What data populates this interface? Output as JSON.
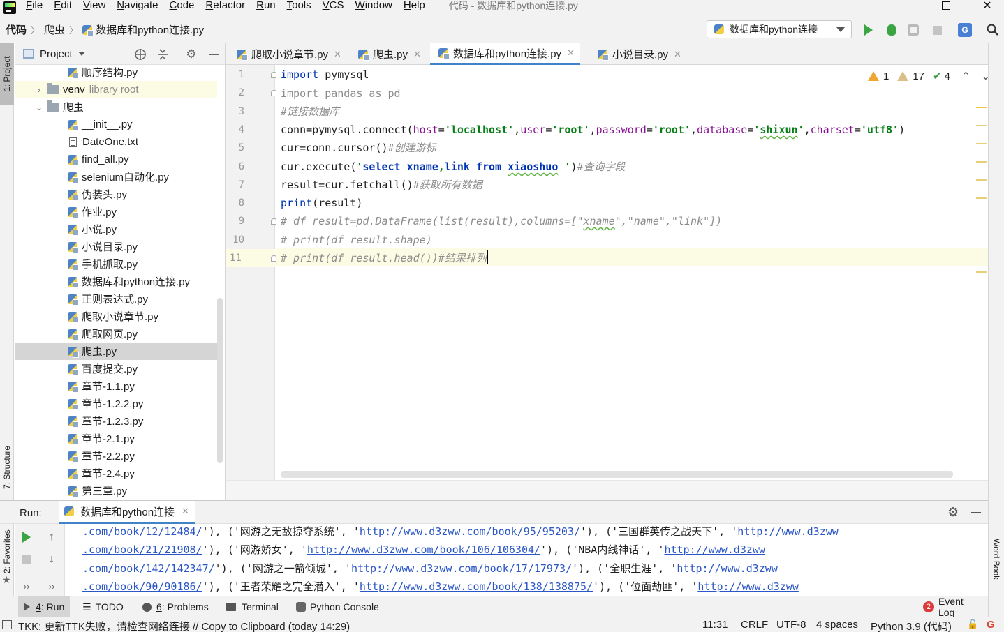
{
  "menubar": {
    "items": [
      {
        "label": "File",
        "u": "F",
        "rest": "ile"
      },
      {
        "label": "Edit",
        "u": "E",
        "rest": "dit"
      },
      {
        "label": "View",
        "u": "V",
        "rest": "iew"
      },
      {
        "label": "Navigate",
        "u": "N",
        "rest": "avigate"
      },
      {
        "label": "Code",
        "u": "C",
        "rest": "ode"
      },
      {
        "label": "Refactor",
        "u": "R",
        "rest": "efactor"
      },
      {
        "label": "Run",
        "u": "R",
        "rest": "un"
      },
      {
        "label": "Tools",
        "u": "T",
        "rest": "ools"
      },
      {
        "label": "VCS",
        "u": "V",
        "rest": "CS"
      },
      {
        "label": "Window",
        "u": "W",
        "rest": "indow"
      },
      {
        "label": "Help",
        "u": "H",
        "rest": "elp"
      }
    ],
    "window_title": "代码 - 数据库和python连接.py"
  },
  "breadcrumb": [
    "代码",
    "爬虫",
    "数据库和python连接.py"
  ],
  "run_config": "数据库和python连接",
  "project": {
    "title": "Project",
    "tree": [
      {
        "label": "顺序结构.py",
        "kind": "py",
        "indent": 2
      },
      {
        "label": "venv",
        "suffix": "library root",
        "kind": "folder",
        "indent": 1,
        "arrow": "›"
      },
      {
        "label": "爬虫",
        "kind": "folder",
        "indent": 1,
        "arrow": "⌄"
      },
      {
        "label": "__init__.py",
        "kind": "py",
        "indent": 2
      },
      {
        "label": "DateOne.txt",
        "kind": "txt",
        "indent": 2
      },
      {
        "label": "find_all.py",
        "kind": "py",
        "indent": 2
      },
      {
        "label": "selenium自动化.py",
        "kind": "py",
        "indent": 2
      },
      {
        "label": "伪装头.py",
        "kind": "py",
        "indent": 2
      },
      {
        "label": "作业.py",
        "kind": "py",
        "indent": 2
      },
      {
        "label": "小说.py",
        "kind": "py",
        "indent": 2
      },
      {
        "label": "小说目录.py",
        "kind": "py",
        "indent": 2
      },
      {
        "label": "手机抓取.py",
        "kind": "py",
        "indent": 2
      },
      {
        "label": "数据库和python连接.py",
        "kind": "py",
        "indent": 2
      },
      {
        "label": "正则表达式.py",
        "kind": "py",
        "indent": 2
      },
      {
        "label": "爬取小说章节.py",
        "kind": "py",
        "indent": 2
      },
      {
        "label": "爬取网页.py",
        "kind": "py",
        "indent": 2
      },
      {
        "label": "爬虫.py",
        "kind": "py",
        "indent": 2,
        "selected": true
      },
      {
        "label": "百度提交.py",
        "kind": "py",
        "indent": 2
      },
      {
        "label": "章节-1.1.py",
        "kind": "py",
        "indent": 2
      },
      {
        "label": "章节-1.2.2.py",
        "kind": "py",
        "indent": 2
      },
      {
        "label": "章节-1.2.3.py",
        "kind": "py",
        "indent": 2
      },
      {
        "label": "章节-2.1.py",
        "kind": "py",
        "indent": 2
      },
      {
        "label": "章节-2.2.py",
        "kind": "py",
        "indent": 2
      },
      {
        "label": "章节-2.4.py",
        "kind": "py",
        "indent": 2
      },
      {
        "label": "第三章.py",
        "kind": "py",
        "indent": 2
      }
    ]
  },
  "tabs": [
    {
      "label": "爬取小说章节.py",
      "active": false
    },
    {
      "label": "爬虫.py",
      "active": false
    },
    {
      "label": "数据库和python连接.py",
      "active": true
    },
    {
      "label": "小说目录.py",
      "active": false
    }
  ],
  "inspections": {
    "warnings": "1",
    "weak_warnings": "17",
    "ok": "4"
  },
  "code": {
    "line_numbers": [
      "1",
      "2",
      "3",
      "4",
      "5",
      "6",
      "7",
      "8",
      "9",
      "10",
      "11"
    ],
    "l1_kw": "import",
    "l1_rest": " pymysql",
    "l2": "import pandas as pd",
    "l3": "#链接数据库",
    "l4_a": "conn=pymysql.connect(",
    "l4_p1": "host",
    "l4_s1": "'localhost'",
    "l4_p2": "user",
    "l4_s2": "'root'",
    "l4_p3": "password",
    "l4_s3": "'root'",
    "l4_p4": "database",
    "l4_s4a": "'",
    "l4_s4b": "shixun",
    "l4_s4c": "'",
    "l4_p5": "charset",
    "l4_s5": "'utf8'",
    "l5_a": "cur=conn.cursor()",
    "l5_c": "#创建游标",
    "l6_a": "cur.execute(",
    "l6_q1": "'",
    "l6_q2": "select",
    "l6_q3": " ",
    "l6_q4": "xname",
    "l6_q5": ",",
    "l6_q6": "link",
    "l6_q7": " ",
    "l6_q8": "from",
    "l6_q9": " ",
    "l6_q10": "xiaoshuo",
    "l6_q11": " '",
    "l6_b": ")",
    "l6_c": "#查询字段",
    "l7_a": "result=cur.fetchall()",
    "l7_c": "#获取所有数据",
    "l8_kw": "print",
    "l8_rest": "(result)",
    "l9_a": "# df_result=pd.DataFrame(list(result),columns=[\"",
    "l9_b": "xname",
    "l9_c": "\",\"name\",\"link\"])",
    "l10": "# print(df_result.shape)",
    "l11": "# print(df_result.head())#结果排列"
  },
  "run": {
    "label": "Run:",
    "tab": "数据库和python连接",
    "lines": [
      {
        "a": ".com/book/12/12484/",
        "b": "'), ('网游之无敌掠夺系统', '",
        "c": "http://www.d3zww.com/book/95/95203/",
        "d": "'), ('三国群英传之战天下', '",
        "e": "http://www.d3zww"
      },
      {
        "a": ".com/book/21/21908/",
        "b": "'), ('网游娇女', '",
        "c": "http://www.d3zww.com/book/106/106304/",
        "d": "'), ('NBA内线神话', '",
        "e": "http://www.d3zww"
      },
      {
        "a": ".com/book/142/142347/",
        "b": "'), ('网游之一箭倾城', '",
        "c": "http://www.d3zww.com/book/17/17973/",
        "d": "'), ('全职生涯', '",
        "e": "http://www.d3zww"
      },
      {
        "a": ".com/book/90/90186/",
        "b": "'), ('王者荣耀之完全潜入', '",
        "c": "http://www.d3zww.com/book/138/138875/",
        "d": "'), ('位面劫匪', '",
        "e": "http://www.d3zww"
      }
    ]
  },
  "bottom_tools": {
    "run": {
      "u": "4",
      "rest": ": Run"
    },
    "todo": "TODO",
    "problems": {
      "u": "6",
      "rest": ": Problems"
    },
    "terminal": "Terminal",
    "python_console": "Python Console",
    "event_log": "Event Log",
    "event_count": "2"
  },
  "side_tabs": {
    "project": "1: Project",
    "structure": "7: Structure",
    "favorites": "2: Favorites",
    "word_book": "Word Book"
  },
  "status": {
    "message": "TKK: 更新TTK失败，请检查网络连接 // Copy to Clipboard (today 14:29)",
    "position": "11:31",
    "line_sep": "CRLF",
    "encoding": "UTF-8",
    "indent": "4 spaces",
    "interpreter": "Python 3.9 (代码)"
  }
}
